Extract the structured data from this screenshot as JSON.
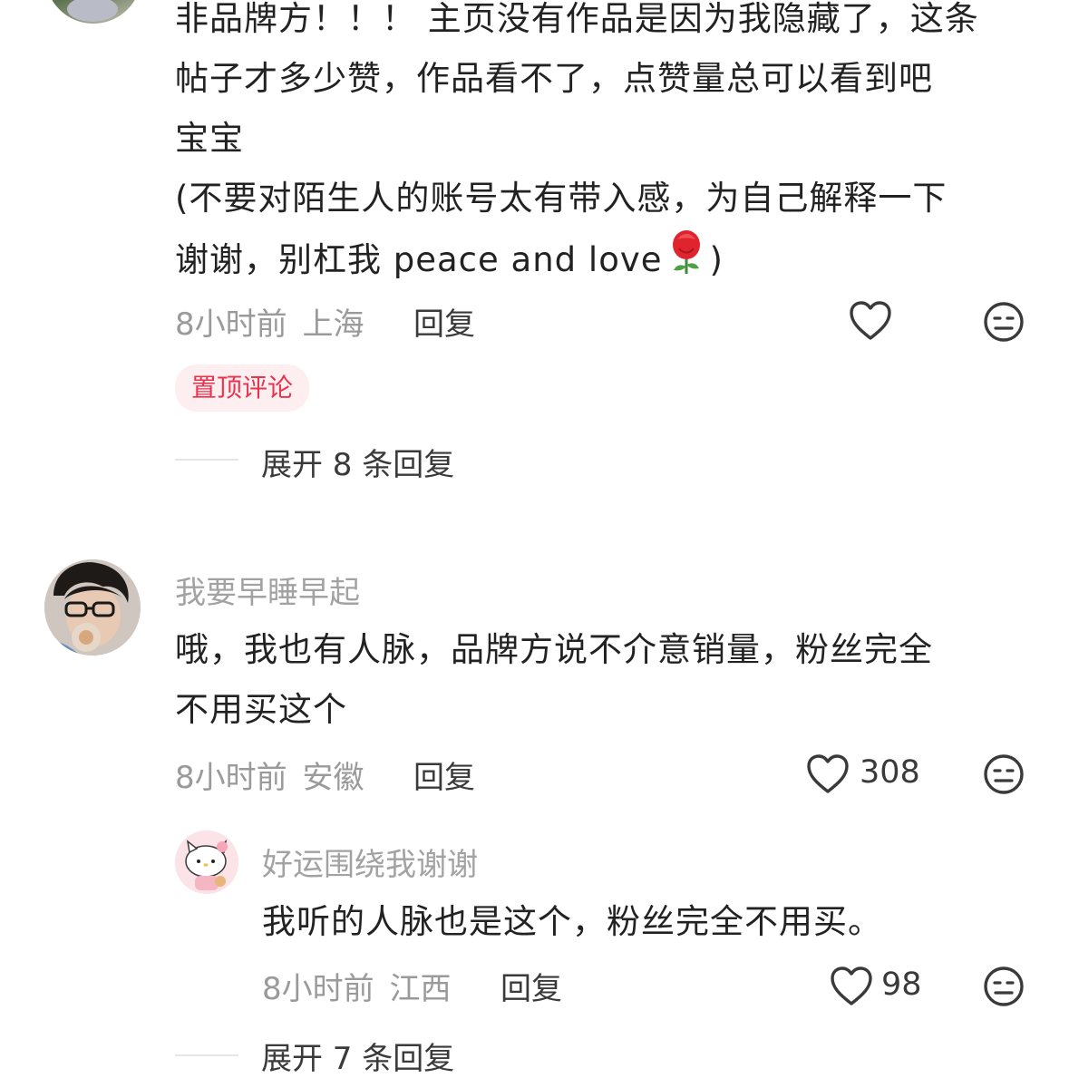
{
  "comment1": {
    "lines": [
      "非品牌方！！！ 主页没有作品是因为我隐藏了，这条",
      "帖子才多少赞，作品看不了，点赞量总可以看到吧",
      "宝宝",
      "(不要对陌生人的账号太有带入感，为自己解释一下",
      "谢谢，别杠我 peace and love"
    ],
    "line5_end": ")",
    "time": "8小时前",
    "location": "上海",
    "reply_label": "回复",
    "pinned_label": "置顶评论",
    "expand_label": "展开 8 条回复"
  },
  "comment2": {
    "username": "我要早睡早起",
    "lines": [
      "哦，我也有人脉，品牌方说不介意销量，粉丝完全",
      "不用买这个"
    ],
    "time": "8小时前",
    "location": "安徽",
    "reply_label": "回复",
    "likes": "308"
  },
  "reply1": {
    "username": "好运围绕我谢谢",
    "text": "我听的人脉也是这个，粉丝完全不用买。",
    "time": "8小时前",
    "location": "江西",
    "reply_label": "回复",
    "likes": "98"
  },
  "comment2_expand_label": "展开 7 条回复",
  "icons": {
    "like": "heart-outline-icon",
    "dislike": "meh-face-icon",
    "rose": "rose-emoji-icon"
  },
  "colors": {
    "pinned_text": "#e8344e",
    "pinned_bg": "#fdeef0",
    "muted": "#9a9a9a"
  }
}
